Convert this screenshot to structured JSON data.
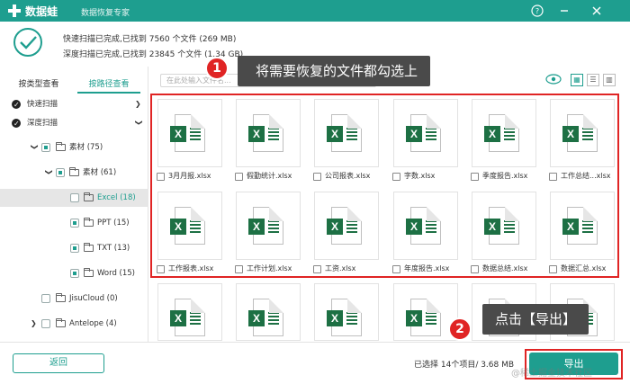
{
  "titlebar": {
    "app_name": "数据蛙",
    "subtitle": "数据恢复专家",
    "help_icon": "question-circle-icon",
    "minimize_icon": "minimize-icon",
    "close_icon": "close-icon"
  },
  "status": {
    "quick_scan": "快速扫描已完成,已找到 7560 个文件 (269 MB)",
    "deep_scan": "深度扫描已完成,已找到 23845 个文件 (1.34 GB)"
  },
  "sidebar": {
    "tabs": [
      {
        "label": "按类型查看",
        "active": false
      },
      {
        "label": "按路径查看",
        "active": true
      }
    ],
    "tree": [
      {
        "label": "快速扫描"
      },
      {
        "label": "深度扫描"
      },
      {
        "label": "素材 (75)"
      },
      {
        "label": "素材 (61)"
      },
      {
        "label": "Excel (18)"
      },
      {
        "label": "PPT (15)"
      },
      {
        "label": "TXT (13)"
      },
      {
        "label": "Word (15)"
      },
      {
        "label": "JisuCloud (0)"
      },
      {
        "label": "Antelope (4)"
      }
    ]
  },
  "toolbar": {
    "search_placeholder": "在此处输入文件名...",
    "view_icons": [
      "eye-icon",
      "grid-view-icon",
      "list-view-icon",
      "detail-view-icon"
    ]
  },
  "files": [
    {
      "name": "3月月报.xlsx"
    },
    {
      "name": "假勤统计.xlsx"
    },
    {
      "name": "公司报表.xlsx"
    },
    {
      "name": "字数.xlsx"
    },
    {
      "name": "季度报告.xlsx"
    },
    {
      "name": "工作总结...xlsx"
    },
    {
      "name": "工作报表.xlsx"
    },
    {
      "name": "工作计划.xlsx"
    },
    {
      "name": "工资.xlsx"
    },
    {
      "name": "年度报告.xlsx"
    },
    {
      "name": "数据总结.xlsx"
    },
    {
      "name": "数据汇总.xlsx"
    }
  ],
  "callouts": {
    "step1_num": "1",
    "step1_text": "将需要恢复的文件都勾选上",
    "step2_num": "2",
    "step2_text": "点击【导出】"
  },
  "bottom": {
    "back_label": "返回",
    "selection_info": "已选择 14个项目/ 3.68 MB",
    "export_label": "导出"
  },
  "colors": {
    "brand": "#1e9e8f",
    "highlight": "#e02424",
    "excel": "#1d7044"
  },
  "watermark": "@稀土掘金技术社区"
}
